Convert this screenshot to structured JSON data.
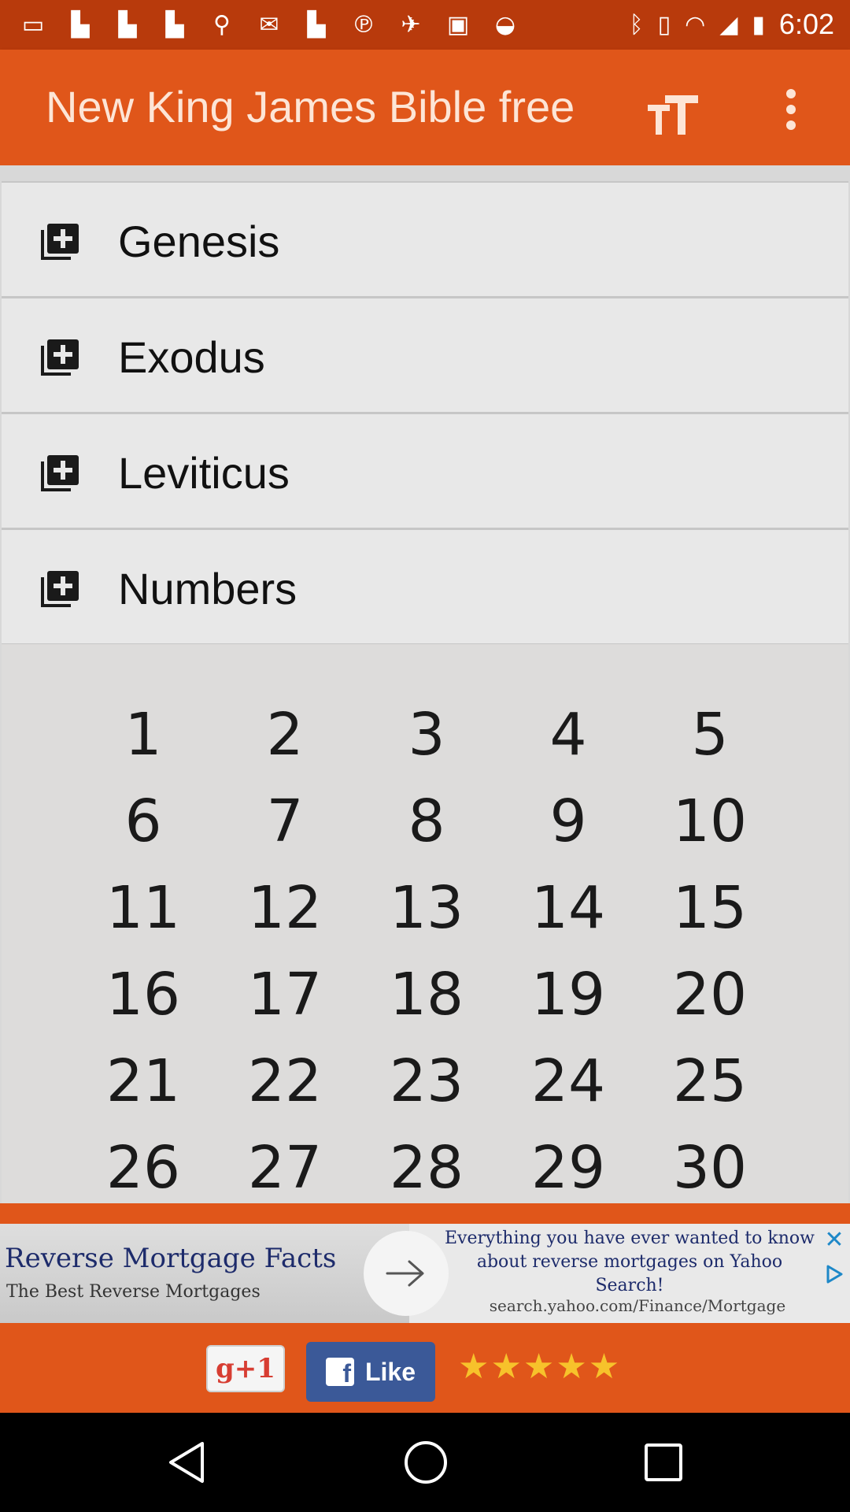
{
  "status_bar": {
    "time": "6:02",
    "left_icons": [
      "message-icon",
      "flipboard-icon",
      "flipboard-icon",
      "flipboard-icon",
      "location-icon",
      "mail-icon",
      "flipboard-icon",
      "pinterest-icon",
      "satellite-icon",
      "lock-icon",
      "android-icon"
    ],
    "right_icons": [
      "bluetooth-icon",
      "vibrate-icon",
      "wifi-icon",
      "signal-icon",
      "battery-icon"
    ]
  },
  "app_bar": {
    "title": "New King James Bible free",
    "text_size_icon": "text-size-icon",
    "overflow_icon": "more-vert-icon"
  },
  "books": [
    {
      "name": "Genesis",
      "icon": "library-add-icon"
    },
    {
      "name": "Exodus",
      "icon": "library-add-icon"
    },
    {
      "name": "Leviticus",
      "icon": "library-add-icon"
    },
    {
      "name": "Numbers",
      "icon": "library-add-icon"
    }
  ],
  "chapters": [
    "1",
    "2",
    "3",
    "4",
    "5",
    "6",
    "7",
    "8",
    "9",
    "10",
    "11",
    "12",
    "13",
    "14",
    "15",
    "16",
    "17",
    "18",
    "19",
    "20",
    "21",
    "22",
    "23",
    "24",
    "25",
    "26",
    "27",
    "28",
    "29",
    "30"
  ],
  "ad": {
    "headline": "Reverse Mortgage Facts",
    "subline": "The Best Reverse Mortgages",
    "description": "Everything you have ever wanted to know about reverse mortgages on Yahoo Search!",
    "url": "search.yahoo.com/Finance/Mortgage"
  },
  "social": {
    "gplus_label": "g+1",
    "like_label": "Like",
    "stars": "★★★★★",
    "rating": 5
  },
  "colors": {
    "status_bar": "#b83a0c",
    "app_bar": "#e0561a",
    "list_bg": "#e8e8e8",
    "facebook": "#3b5998",
    "star": "#f7c22b"
  }
}
